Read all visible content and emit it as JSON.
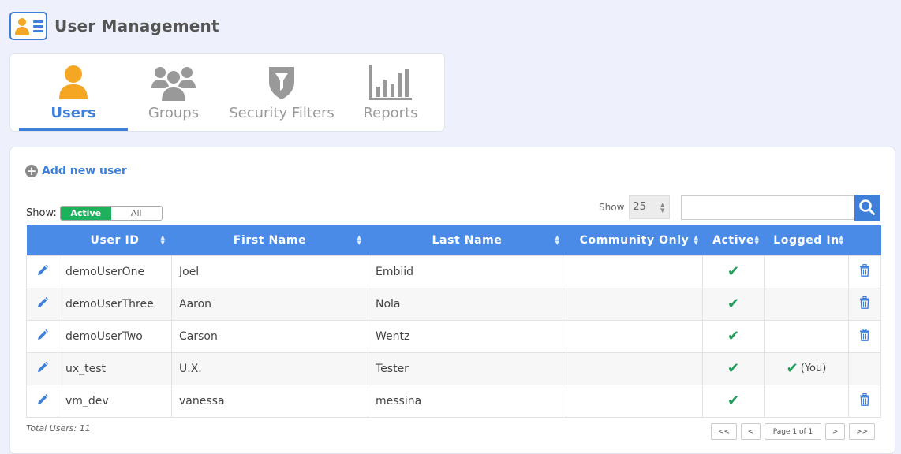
{
  "header": {
    "title": "User Management"
  },
  "tabs": [
    {
      "label": "Users",
      "active": true,
      "icon": "user-icon"
    },
    {
      "label": "Groups",
      "active": false,
      "icon": "group-icon"
    },
    {
      "label": "Security Filters",
      "active": false,
      "icon": "shield-filter-icon"
    },
    {
      "label": "Reports",
      "active": false,
      "icon": "bar-chart-icon"
    }
  ],
  "toolbar": {
    "add_user_label": "Add new user",
    "show_label": "Show:",
    "filter_active": "Active",
    "filter_all": "All",
    "page_size_label": "Show",
    "page_size_value": "25",
    "search_placeholder": ""
  },
  "table": {
    "columns": [
      "User ID",
      "First Name",
      "Last Name",
      "Community Only",
      "Active",
      "Logged In"
    ],
    "rows": [
      {
        "user_id": "demoUserOne",
        "first": "Joel",
        "last": "Embiid",
        "community": "",
        "active": true,
        "logged_in": ""
      },
      {
        "user_id": "demoUserThree",
        "first": "Aaron",
        "last": "Nola",
        "community": "",
        "active": true,
        "logged_in": ""
      },
      {
        "user_id": "demoUserTwo",
        "first": "Carson",
        "last": "Wentz",
        "community": "",
        "active": true,
        "logged_in": ""
      },
      {
        "user_id": "ux_test",
        "first": "U.X.",
        "last": "Tester",
        "community": "",
        "active": true,
        "logged_in": "(You)"
      },
      {
        "user_id": "vm_dev",
        "first": "vanessa",
        "last": "messina",
        "community": "",
        "active": true,
        "logged_in": ""
      }
    ]
  },
  "footer": {
    "total": "Total Users: 11",
    "pager": {
      "first": "<<",
      "prev": "<",
      "page": "Page 1 of 1",
      "next": ">",
      "last": ">>"
    }
  },
  "colors": {
    "accent": "#3d7fd9",
    "header_bg": "#4a8be8",
    "active_green": "#1db15b",
    "check_green": "#1e9e59",
    "user_icon": "#f5a623"
  }
}
